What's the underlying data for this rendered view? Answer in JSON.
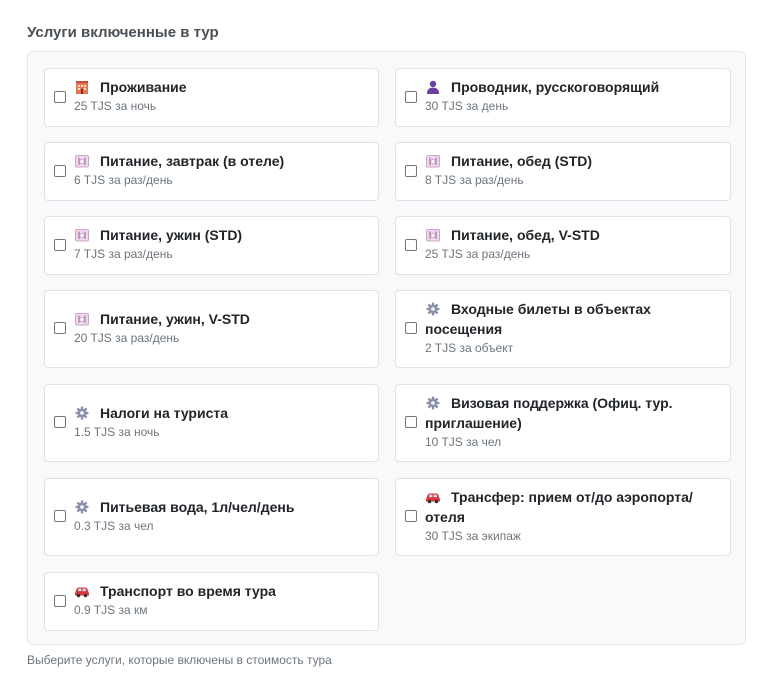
{
  "section": {
    "title": "Услуги включенные в тур",
    "hint": "Выберите услуги, которые включены в стоимость тура"
  },
  "services": [
    {
      "title": "Проживание",
      "price": "25 TJS за ночь",
      "icon": "hotel-icon",
      "checked": false
    },
    {
      "title": "Проводник, русскоговорящий",
      "price": "30 TJS за день",
      "icon": "guide-icon",
      "checked": false
    },
    {
      "title": "Питание, завтрак (в отеле)",
      "price": "6 TJS за раз/день",
      "icon": "meal-icon",
      "checked": false
    },
    {
      "title": "Питание, обед (STD)",
      "price": "8 TJS за раз/день",
      "icon": "meal-icon",
      "checked": false
    },
    {
      "title": "Питание, ужин (STD)",
      "price": "7 TJS за раз/день",
      "icon": "meal-icon",
      "checked": false
    },
    {
      "title": "Питание, обед, V-STD",
      "price": "25 TJS за раз/день",
      "icon": "meal-icon",
      "checked": false
    },
    {
      "title": "Питание, ужин, V-STD",
      "price": "20 TJS за раз/день",
      "icon": "meal-icon",
      "checked": false
    },
    {
      "title": "Входные билеты в объектах посещения",
      "price": "2 TJS за объект",
      "icon": "gear-icon",
      "checked": false
    },
    {
      "title": "Налоги на туриста",
      "price": "1.5 TJS за ночь",
      "icon": "gear-icon",
      "checked": false
    },
    {
      "title": "Визовая поддержка (Офиц. тур. приглашение)",
      "price": "10 TJS за чел",
      "icon": "gear-icon",
      "checked": false
    },
    {
      "title": "Питьевая вода, 1л/чел/день",
      "price": "0.3 TJS за чел",
      "icon": "gear-icon",
      "checked": false
    },
    {
      "title": "Трансфер: прием от/до аэропорта/ отеля",
      "price": "30 TJS за экипаж",
      "icon": "car-icon",
      "checked": false
    },
    {
      "title": "Транспорт во время тура",
      "price": "0.9 TJS за км",
      "icon": "car-icon",
      "checked": false
    }
  ]
}
